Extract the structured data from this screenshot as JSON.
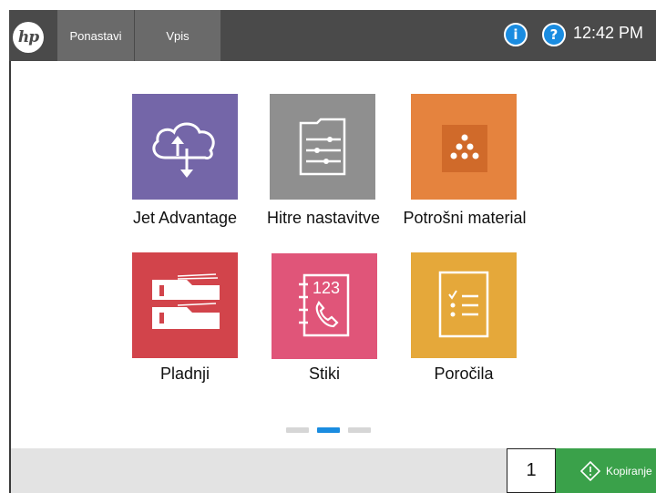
{
  "header": {
    "logo_text": "hp",
    "tabs": [
      {
        "label": "Ponastavi"
      },
      {
        "label": "Vpis"
      }
    ],
    "info_symbol": "i",
    "help_symbol": "?",
    "time": "12:42 PM"
  },
  "apps": [
    {
      "label": "Jet Advantage",
      "icon": "cloud-transfer-icon",
      "color": "#7466a8"
    },
    {
      "label": "Hitre nastavitve",
      "icon": "settings-folder-icon",
      "color": "#8f8f8f"
    },
    {
      "label": "Potrošni material",
      "icon": "toner-cartridge-icon",
      "color": "#e5833e"
    },
    {
      "label": "Pladnji",
      "icon": "paper-trays-icon",
      "color": "#d2444b"
    },
    {
      "label": "Stiki",
      "icon": "contacts-book-icon",
      "color": "#e05579"
    },
    {
      "label": "Poročila",
      "icon": "report-checklist-icon",
      "color": "#e5a83a"
    }
  ],
  "contacts_icon_number": "123",
  "pagination": {
    "page_count": 3,
    "active_page": 2
  },
  "footer": {
    "copies": "1",
    "copy_label": "Kopiranje",
    "copy_color": "#3aa14a"
  }
}
